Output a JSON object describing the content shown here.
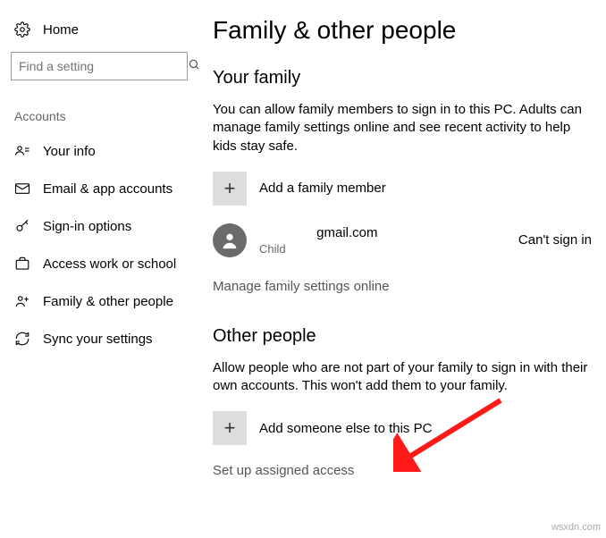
{
  "sidebar": {
    "home": "Home",
    "search_placeholder": "Find a setting",
    "section": "Accounts",
    "items": [
      {
        "label": "Your info"
      },
      {
        "label": "Email & app accounts"
      },
      {
        "label": "Sign-in options"
      },
      {
        "label": "Access work or school"
      },
      {
        "label": "Family & other people"
      },
      {
        "label": "Sync your settings"
      }
    ]
  },
  "main": {
    "title": "Family & other people",
    "family": {
      "heading": "Your family",
      "desc": "You can allow family members to sign in to this PC. Adults can manage family settings online and see recent activity to help kids stay safe.",
      "add_label": "Add a family member",
      "member": {
        "email_domain": "gmail.com",
        "role": "Child",
        "status": "Can't sign in"
      },
      "manage": "Manage family settings online"
    },
    "other": {
      "heading": "Other people",
      "desc": "Allow people who are not part of your family to sign in with their own accounts. This won't add them to your family.",
      "add_label": "Add someone else to this PC",
      "assigned": "Set up assigned access"
    }
  },
  "watermark": "wsxdn.com"
}
